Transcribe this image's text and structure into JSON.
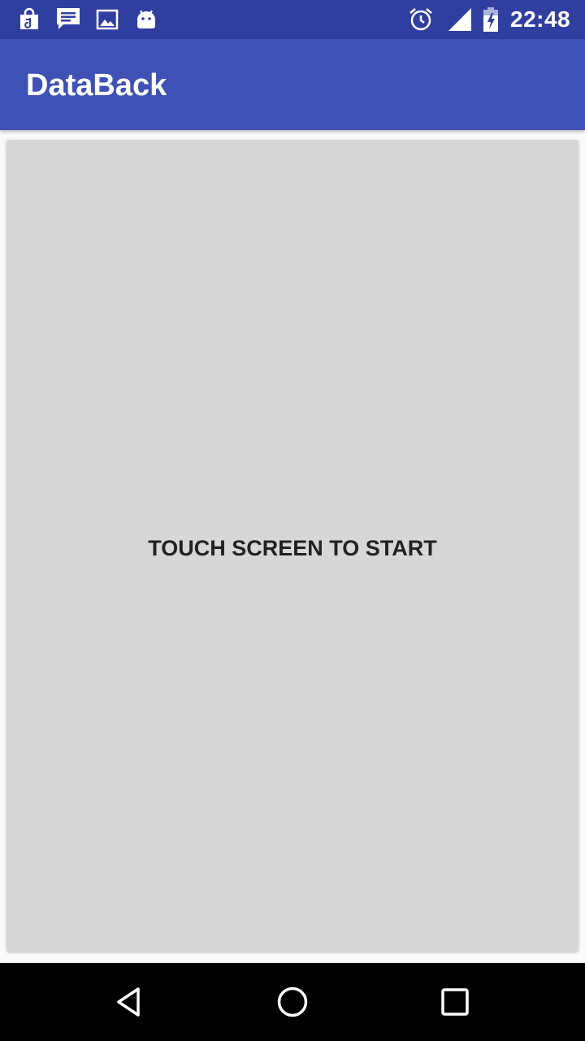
{
  "status_bar": {
    "time": "22:48",
    "notification_icons": [
      "shopping-bag-icon",
      "message-icon",
      "image-icon",
      "android-icon"
    ],
    "system_icons": [
      "alarm-icon",
      "signal-icon",
      "battery-charging-icon"
    ]
  },
  "app_bar": {
    "title": "DataBack",
    "color": "#3f51b5",
    "status_color": "#303f9f"
  },
  "main": {
    "touch_prompt": "TOUCH SCREEN TO START",
    "card_color": "#d6d7d7"
  },
  "nav_bar": {
    "buttons": [
      "back-icon",
      "home-icon",
      "recents-icon"
    ]
  }
}
